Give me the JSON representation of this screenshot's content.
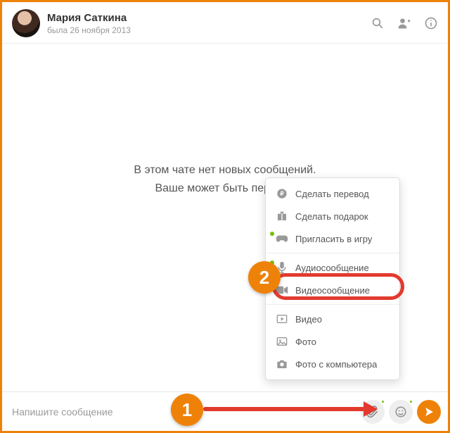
{
  "header": {
    "name": "Мария Саткина",
    "last_seen": "была 26 ноября 2013"
  },
  "empty": {
    "line1": "В этом чате нет новых сообщений.",
    "line2": "Ваше может быть первым!"
  },
  "menu": {
    "items": [
      {
        "label": "Сделать перевод",
        "icon": "ruble-icon"
      },
      {
        "label": "Сделать подарок",
        "icon": "gift-icon"
      },
      {
        "label": "Пригласить в игру",
        "icon": "gamepad-icon",
        "new": true
      },
      {
        "label": "Аудиосообщение",
        "icon": "microphone-icon",
        "new": true
      },
      {
        "label": "Видеосообщение",
        "icon": "videocam-icon",
        "new": true
      },
      {
        "label": "Видео",
        "icon": "play-box-icon"
      },
      {
        "label": "Фото",
        "icon": "image-icon"
      },
      {
        "label": "Фото с компьютера",
        "icon": "camera-icon"
      }
    ]
  },
  "composer": {
    "placeholder": "Напишите сообщение"
  },
  "annotations": {
    "step1": "1",
    "step2": "2"
  },
  "colors": {
    "accent_orange": "#ee8208",
    "callout_red": "#e23a2e",
    "new_green": "#73c200"
  }
}
